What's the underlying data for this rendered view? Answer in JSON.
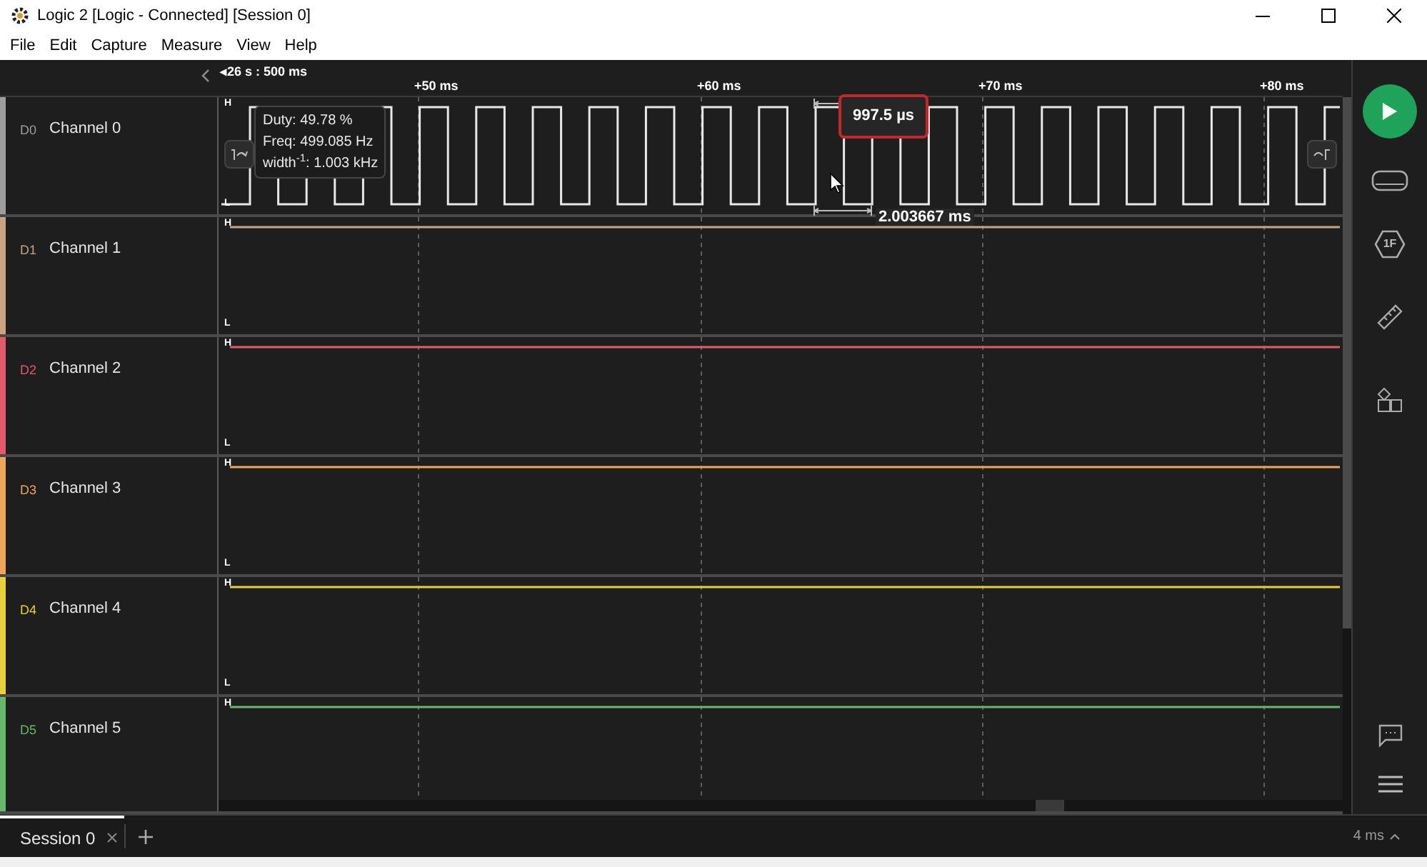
{
  "window": {
    "title": "Logic 2 [Logic - Connected] [Session 0]"
  },
  "menu": [
    "File",
    "Edit",
    "Capture",
    "Measure",
    "View",
    "Help"
  ],
  "timeline": {
    "start": "◂26 s : 500 ms",
    "ticks": [
      "+50 ms",
      "+60 ms",
      "+70 ms",
      "+80 ms"
    ]
  },
  "channels": [
    {
      "id": "D0",
      "name": "Channel 0",
      "color": "#9e9e9e",
      "kind": "clock",
      "high_label": "H",
      "low_label": "L"
    },
    {
      "id": "D1",
      "name": "Channel 1",
      "color": "#c9a384",
      "kind": "flat",
      "high_label": "H",
      "low_label": "L"
    },
    {
      "id": "D2",
      "name": "Channel 2",
      "color": "#e25a6c",
      "kind": "flat",
      "high_label": "H",
      "low_label": "L"
    },
    {
      "id": "D3",
      "name": "Channel 3",
      "color": "#f0a55c",
      "kind": "flat",
      "high_label": "H",
      "low_label": "L"
    },
    {
      "id": "D4",
      "name": "Channel 4",
      "color": "#e8cf3e",
      "kind": "flat",
      "high_label": "H",
      "low_label": "L"
    },
    {
      "id": "D5",
      "name": "Channel 5",
      "color": "#66b86a",
      "kind": "flat",
      "high_label": "H"
    }
  ],
  "measurement": {
    "duty": "Duty: 49.78 %",
    "freq": "Freq: 499.085 Hz",
    "width": "width$^{-1}$: 1.003 kHz",
    "pulse_width": "997.5 µs",
    "period": "2.003667 ms"
  },
  "sidebar": {
    "extensions_badge": "1F"
  },
  "session_tabs": [
    {
      "label": "Session 0",
      "selected": true
    }
  ],
  "status": {
    "zoom": "4 ms"
  }
}
